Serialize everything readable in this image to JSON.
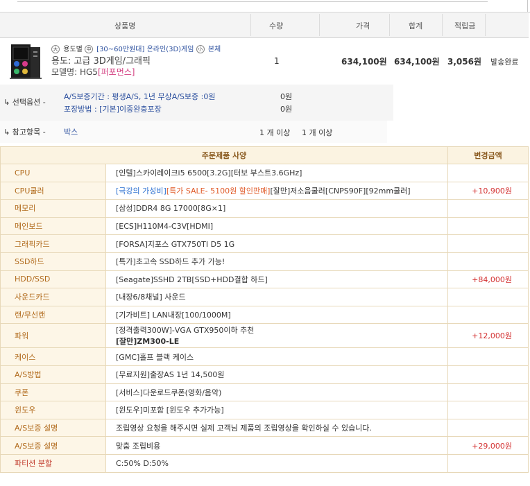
{
  "order": {
    "headers": {
      "product": "상품명",
      "qty": "수량",
      "price": "가격",
      "total": "합계",
      "points": "적립금"
    },
    "product": {
      "image_icon": "pc-case-icon",
      "tag_badges": [
        "大",
        "中",
        "小"
      ],
      "tag_prefix": "용도별",
      "tag_category": "[30~60만원대] 온라인(3D)게임",
      "tag_suffix": "본체",
      "purpose": "용도: 고급 3D게임/그래픽",
      "model_label": "모델명: HG5",
      "model_highlight": "[퍼포먼스]"
    },
    "qty": "1",
    "price": "634,100원",
    "total": "634,100원",
    "points": "3,056원",
    "status": "발송완료",
    "options_label": "↳ 선택옵션 -",
    "options": [
      {
        "text": "A/S보증기간 : 평생A/S, 1년 무상A/S보증 :0원",
        "price": "0원"
      },
      {
        "text": "포장방법 : [기본]이중완충포장",
        "price": "0원"
      }
    ],
    "reference_label": "↳ 참고항목 -",
    "reference_item": "박스",
    "reference_qty": "1 개 이상",
    "reference_qty2": "1 개 이상"
  },
  "spec": {
    "headers": {
      "spec": "주문제품 사양",
      "change": "변경금액"
    },
    "rows": [
      {
        "name": "CPU",
        "value": "[인텔]스카이레이크i5 6500[3.2G][터보 부스트3.6GHz]",
        "change": ""
      },
      {
        "name": "CPU쿨러",
        "promo_a": "[극강의 가성비]",
        "promo_b": "[특가 SALE- 5100원 할인판매]",
        "value": "[잘만]저소음쿨러[CNPS90F][92mm쿨러]",
        "change": "+10,900원"
      },
      {
        "name": "메모리",
        "value": "[삼성]DDR4 8G 17000[8G×1]",
        "change": ""
      },
      {
        "name": "메인보드",
        "value": "[ECS]H110M4-C3V[HDMI]",
        "change": ""
      },
      {
        "name": "그래픽카드",
        "value": "[FORSA]지포스 GTX750TI D5 1G",
        "change": ""
      },
      {
        "name": "SSD하드",
        "value": "[특가]초고속 SSD하드 추가 가능!",
        "change": ""
      },
      {
        "name": "HDD/SSD",
        "value": "[Seagate]SSHD 2TB[SSD+HDD결합 하드]",
        "change": "+84,000원"
      },
      {
        "name": "사운드카드",
        "value": "[내장6/8채널] 사운드",
        "change": ""
      },
      {
        "name": "랜/무선랜",
        "value": "[기가비트] LAN내장[100/1000M]",
        "change": ""
      },
      {
        "name": "파워",
        "value": "[정격출력300W]-VGA GTX950이하 추천",
        "value2": "[잘만]ZM300-LE",
        "change": "+12,000원"
      },
      {
        "name": "케이스",
        "value": "[GMC]홀프 블랙 케이스",
        "change": ""
      },
      {
        "name": "A/S방법",
        "value": "[무료지원]출장AS 1년 14,500원",
        "change": ""
      },
      {
        "name": "쿠폰",
        "value": "[서비스]다운로드쿠폰(영화/음악)",
        "change": ""
      },
      {
        "name": "윈도우",
        "value": "[윈도우]미포함 [윈도우 추가가능]",
        "change": ""
      },
      {
        "name": "A/S보증 설명",
        "value": "조립영상 요청을 해주시면 실제 고객님 제품의 조립영상을 확인하실 수 있습니다.",
        "change": ""
      },
      {
        "name": "A/S보증 설명",
        "value": "맞춤 조립비용",
        "change": "+29,000원"
      },
      {
        "name": "파티션 분할",
        "value": "C:50% D:50%",
        "change": ""
      }
    ]
  }
}
